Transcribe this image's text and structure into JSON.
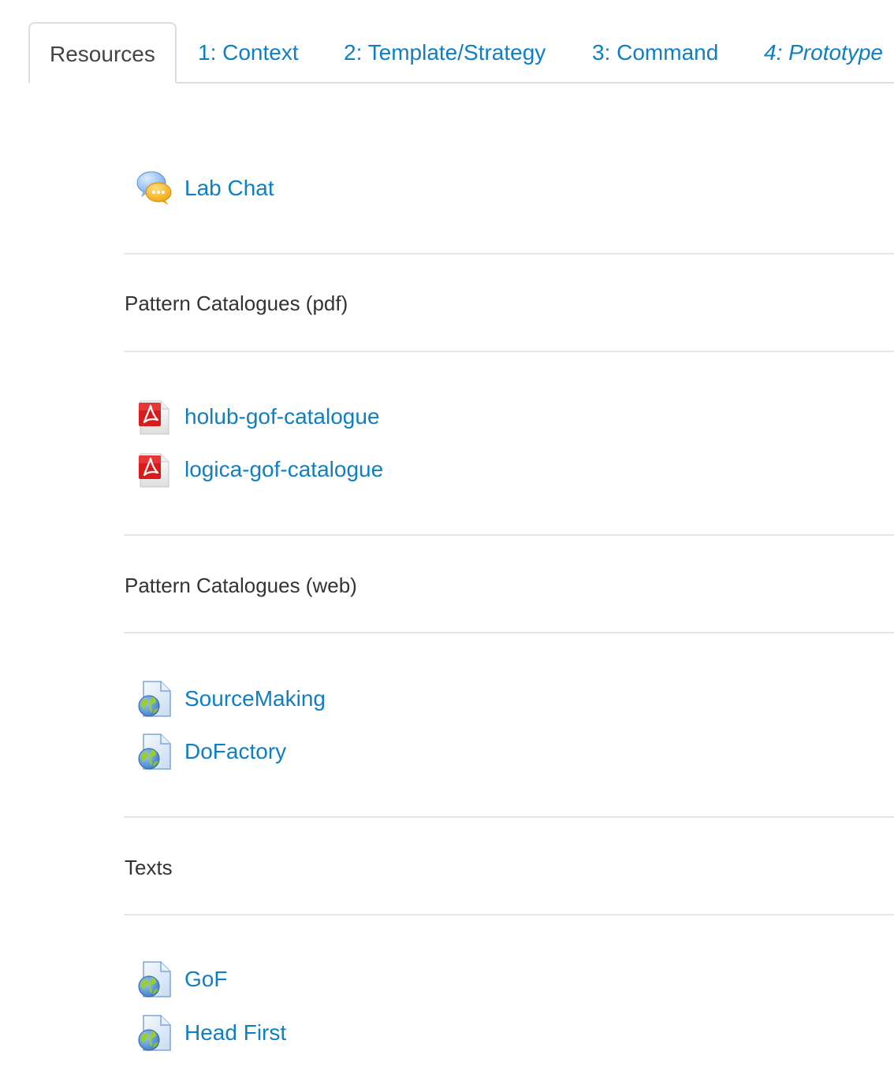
{
  "tabs": [
    {
      "label": "Resources",
      "active": true
    },
    {
      "label": "1: Context",
      "active": false
    },
    {
      "label": "2: Template/Strategy",
      "active": false
    },
    {
      "label": "3: Command",
      "active": false
    },
    {
      "label": "4: Prototype",
      "active": false,
      "italic": true
    }
  ],
  "chat": {
    "label": "Lab Chat",
    "icon": "chat-icon"
  },
  "sections": [
    {
      "name": "Pattern Catalogues (pdf)",
      "items": [
        {
          "label": "holub-gof-catalogue",
          "icon": "pdf-icon"
        },
        {
          "label": "logica-gof-catalogue",
          "icon": "pdf-icon"
        }
      ]
    },
    {
      "name": "Pattern Catalogues (web)",
      "items": [
        {
          "label": "SourceMaking",
          "icon": "web-page-icon"
        },
        {
          "label": "DoFactory",
          "icon": "web-page-icon"
        }
      ]
    },
    {
      "name": "Texts",
      "items": [
        {
          "label": "GoF",
          "icon": "web-page-icon"
        },
        {
          "label": "Head First",
          "icon": "web-page-icon"
        }
      ]
    }
  ],
  "colors": {
    "link": "#0f7fc3",
    "text": "#333333",
    "border": "#dddddd",
    "divider": "#e6e6e6"
  }
}
